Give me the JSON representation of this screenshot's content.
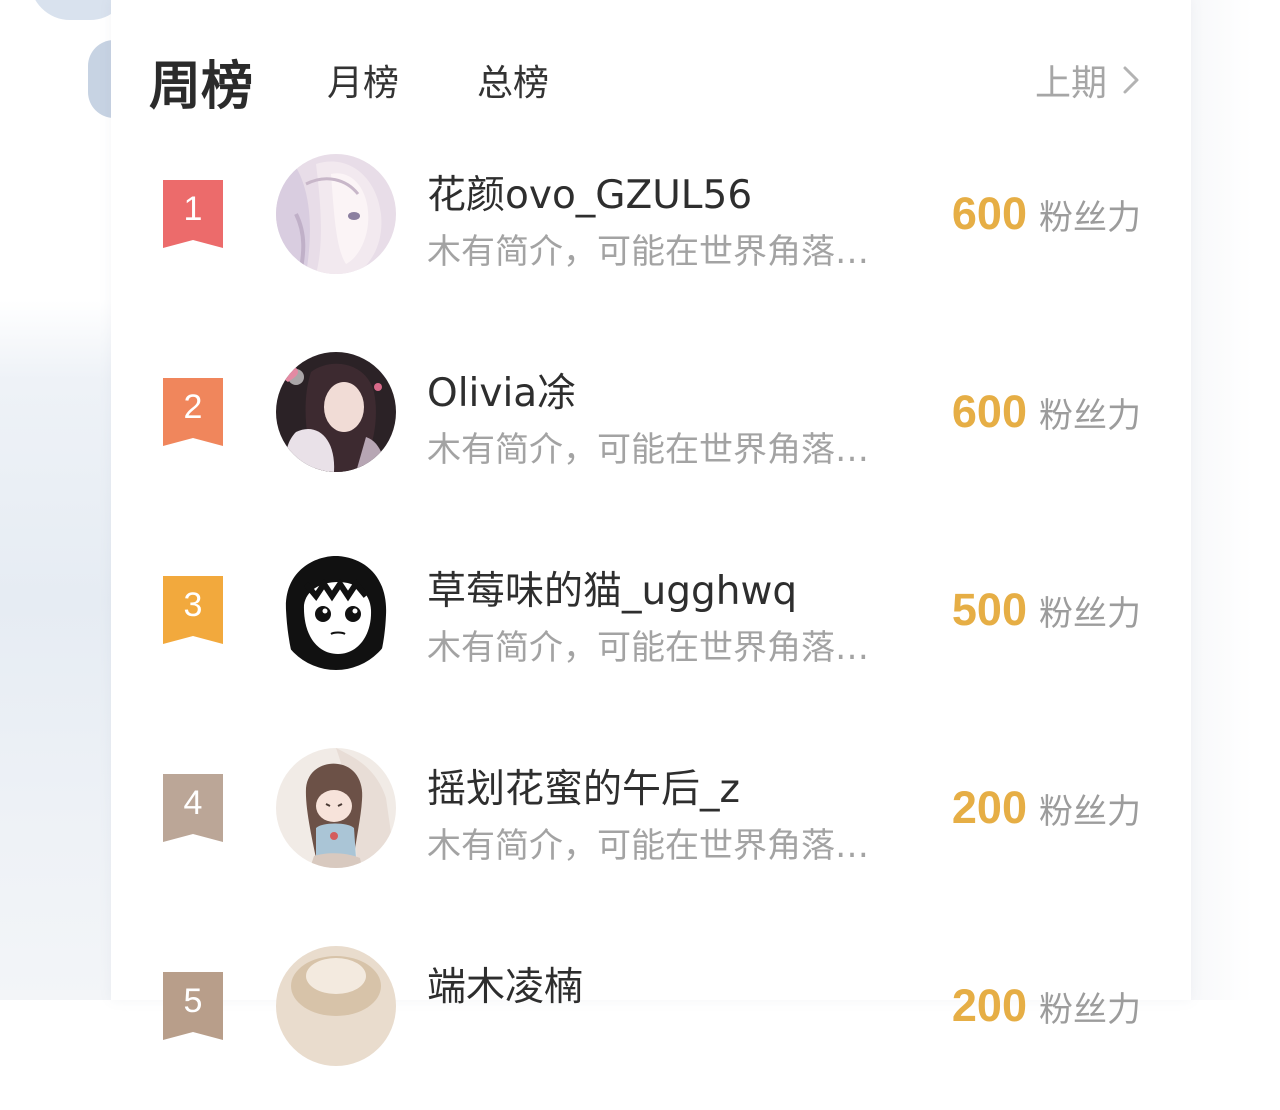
{
  "tabs": {
    "week": "周榜",
    "month": "月榜",
    "total": "总榜",
    "previous": "上期"
  },
  "colors": {
    "rank_1": "#ec6b6b",
    "rank_2": "#f0865c",
    "rank_3": "#f2a93d",
    "rank_4": "#bba697",
    "rank_5": "#b89e8a",
    "score": "#e6ae45"
  },
  "icons": {
    "previous": "chevron-right-icon",
    "badge": "ribbon-badge-icon"
  },
  "ranking": [
    {
      "rank": "1",
      "name": "花颜ovo_GZUL56",
      "bio": "木有简介，可能在世界角落…",
      "score": "600",
      "unit": "粉丝力"
    },
    {
      "rank": "2",
      "name": "Olivia凃",
      "bio": "木有简介，可能在世界角落…",
      "score": "600",
      "unit": "粉丝力"
    },
    {
      "rank": "3",
      "name": "草莓味的猫_ugghwq",
      "bio": "木有简介，可能在世界角落…",
      "score": "500",
      "unit": "粉丝力"
    },
    {
      "rank": "4",
      "name": "摇划花蜜的午后_z",
      "bio": "木有简介，可能在世界角落…",
      "score": "200",
      "unit": "粉丝力"
    },
    {
      "rank": "5",
      "name": "端木凌楠",
      "bio": "",
      "score": "200",
      "unit": "粉丝力"
    }
  ]
}
